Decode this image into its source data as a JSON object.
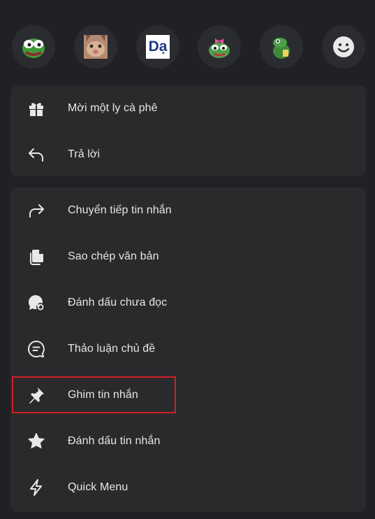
{
  "reactions": [
    {
      "name": "pepe-frog-sticker",
      "kind": "sticker"
    },
    {
      "name": "cat-face-sticker",
      "kind": "sticker"
    },
    {
      "name": "da-sticker",
      "kind": "text",
      "text": "Dạ"
    },
    {
      "name": "pepe-bow-sticker",
      "kind": "sticker"
    },
    {
      "name": "frog-sticker",
      "kind": "sticker"
    },
    {
      "name": "smiley-icon",
      "kind": "emoji"
    }
  ],
  "menu_primary": [
    {
      "label": "Mời một ly cà phê",
      "icon": "gift-icon"
    },
    {
      "label": "Trả lời",
      "icon": "reply-icon"
    }
  ],
  "menu_secondary": [
    {
      "label": "Chuyển tiếp tin nhắn",
      "icon": "forward-icon"
    },
    {
      "label": "Sao chép văn bản",
      "icon": "copy-icon"
    },
    {
      "label": "Đánh dấu chưa đọc",
      "icon": "mark-unread-icon"
    },
    {
      "label": "Thảo luận chủ đề",
      "icon": "thread-icon"
    },
    {
      "label": "Ghim tin nhắn",
      "icon": "pin-icon"
    },
    {
      "label": "Đánh dấu tin nhắn",
      "icon": "star-icon"
    },
    {
      "label": "Quick Menu",
      "icon": "bolt-icon"
    }
  ],
  "colors": {
    "background": "#202124",
    "card": "#2a2a2c",
    "highlight_border": "#d11f26",
    "text": "#e6e6e6"
  }
}
